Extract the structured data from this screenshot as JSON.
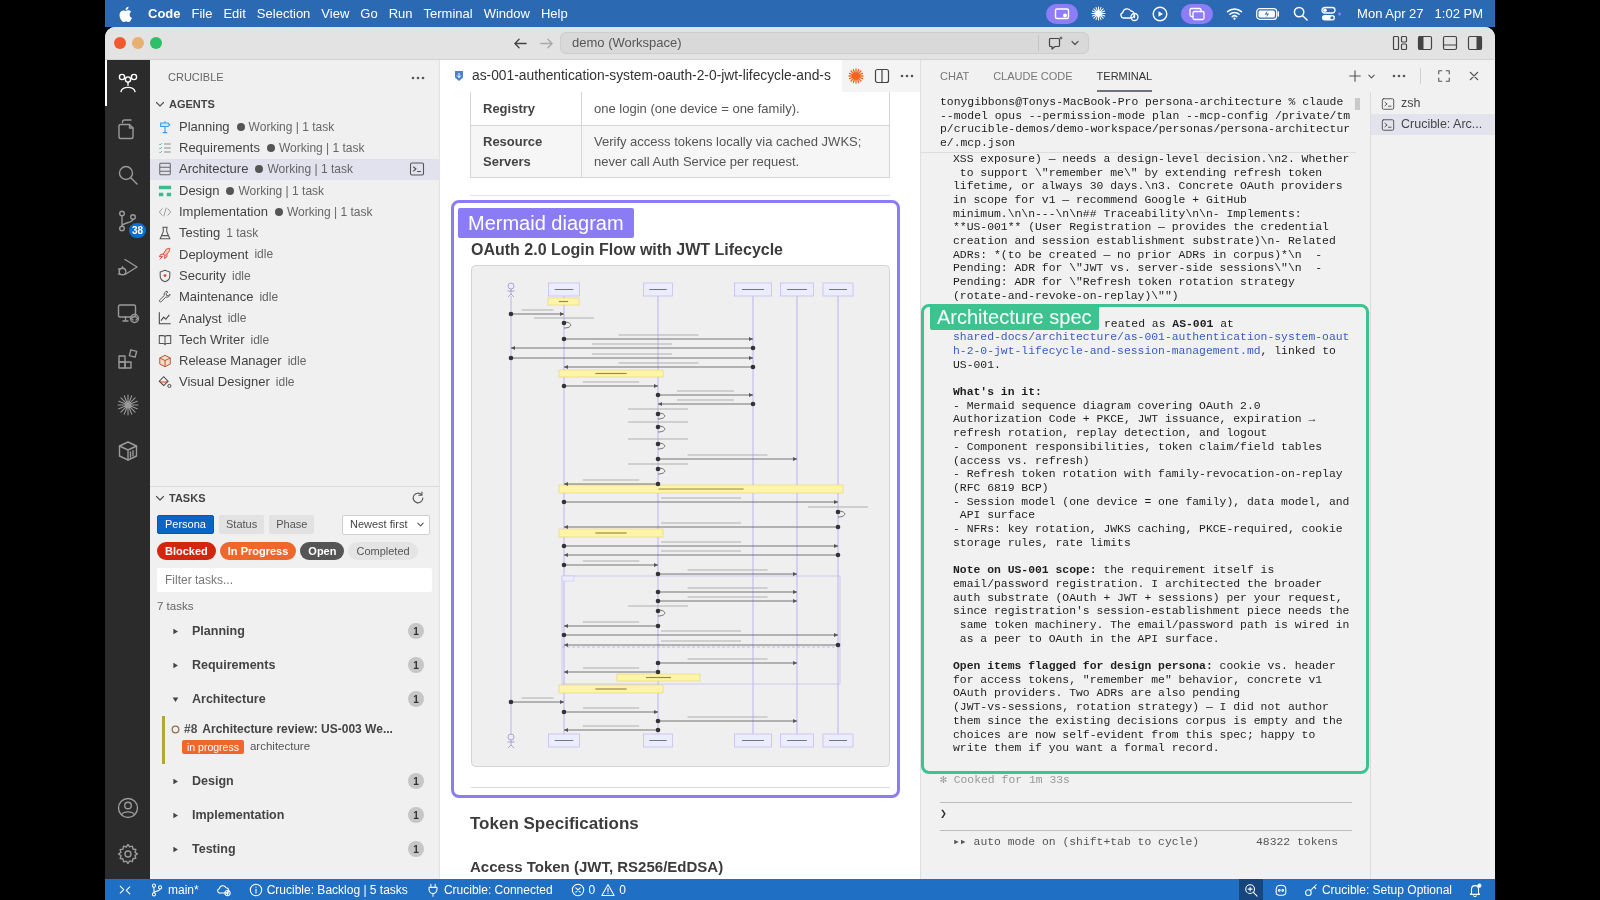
{
  "menu_bar": {
    "app": "Code",
    "menus": [
      "File",
      "Edit",
      "Selection",
      "View",
      "Go",
      "Run",
      "Terminal",
      "Window",
      "Help"
    ],
    "date": "Mon Apr 27",
    "time": "1:02 PM"
  },
  "title_bar": {
    "back": {
      "disabled": false
    },
    "forward": {
      "disabled": true
    },
    "command_center": "demo (Workspace)"
  },
  "activity_bar": {
    "items": [
      {
        "selected": true
      },
      {
        "selected": false
      },
      {
        "selected": false
      },
      {
        "selected": false,
        "badge": "38"
      },
      {
        "selected": false
      },
      {
        "selected": false
      },
      {
        "selected": false
      },
      {
        "selected": false
      },
      {
        "selected": false
      }
    ]
  },
  "sidebar": {
    "title": "CRUCIBLE",
    "agents": {
      "title": "AGENTS",
      "expanded": true,
      "items": [
        {
          "name": "Planning",
          "status": "Working | 1 task",
          "working": true,
          "selected": false
        },
        {
          "name": "Requirements",
          "status": "Working | 1 task",
          "working": true,
          "selected": false
        },
        {
          "name": "Architecture",
          "status": "Working | 1 task",
          "working": true,
          "selected": true
        },
        {
          "name": "Design",
          "status": "Working | 1 task",
          "working": true,
          "selected": false
        },
        {
          "name": "Implementation",
          "status": "Working | 1 task",
          "working": true,
          "selected": false
        },
        {
          "name": "Testing",
          "status": "1 task",
          "working": false,
          "selected": false
        },
        {
          "name": "Deployment",
          "status": "idle",
          "working": false,
          "selected": false
        },
        {
          "name": "Security",
          "status": "idle",
          "working": false,
          "selected": false
        },
        {
          "name": "Maintenance",
          "status": "idle",
          "working": false,
          "selected": false
        },
        {
          "name": "Analyst",
          "status": "idle",
          "working": false,
          "selected": false
        },
        {
          "name": "Tech Writer",
          "status": "idle",
          "working": false,
          "selected": false
        },
        {
          "name": "Release Manager",
          "status": "idle",
          "working": false,
          "selected": false
        },
        {
          "name": "Visual Designer",
          "status": "idle",
          "working": false,
          "selected": false
        }
      ]
    },
    "tasks": {
      "title": "TASKS",
      "expanded": true,
      "group_by": [
        {
          "label": "Persona",
          "selected": true
        },
        {
          "label": "Status",
          "selected": false
        },
        {
          "label": "Phase",
          "selected": false
        }
      ],
      "sort": "Newest first",
      "status_filters": [
        {
          "label": "Blocked",
          "selected": true,
          "color": "#d3260f"
        },
        {
          "label": "In Progress",
          "selected": true,
          "color": "#f0672b"
        },
        {
          "label": "Open",
          "selected": true,
          "color": "#555555"
        },
        {
          "label": "Completed",
          "selected": false
        }
      ],
      "filter": {
        "placeholder": "Filter tasks..."
      },
      "count": "7 tasks",
      "groups": [
        {
          "name": "Planning",
          "count": "1",
          "expanded": false
        },
        {
          "name": "Requirements",
          "count": "1",
          "expanded": false
        },
        {
          "name": "Architecture",
          "count": "1",
          "expanded": true,
          "tasks": [
            {
              "number": "#8",
              "title": "Architecture review: US-003 We...",
              "status": {
                "label": "in progress",
                "color": "#f0672b"
              },
              "tag": "architecture"
            }
          ]
        },
        {
          "name": "Design",
          "count": "1",
          "expanded": false
        },
        {
          "name": "Implementation",
          "count": "1",
          "expanded": false
        },
        {
          "name": "Testing",
          "count": "1",
          "expanded": false
        }
      ]
    }
  },
  "editor": {
    "tab": {
      "title": "as-001-authentication-system-oauth-2-0-jwt-lifecycle-and-s"
    },
    "table": {
      "rows": [
        [
          "Registry",
          "one login (one device = one family)."
        ],
        [
          "Resource Servers",
          "Verify access tokens locally via cached JWKS; never call Auth Service per request."
        ]
      ]
    },
    "highlight": {
      "label": "Mermaid diagram"
    },
    "diagram_heading": "OAuth 2.0 Login Flow with JWT Lifecycle",
    "headings": [
      "Token Specifications",
      "Access Token (JWT, RS256/EdDSA)"
    ]
  },
  "panel": {
    "tabs": [
      {
        "label": "CHAT",
        "selected": false
      },
      {
        "label": "CLAUDE CODE",
        "selected": false
      },
      {
        "label": "TERMINAL",
        "selected": true
      }
    ],
    "terminal": {
      "command": "tonygibbons@Tonys-MacBook-Pro persona-architecture % claude\n--model opus --permission-mode plan --mcp-config /private/tm\np/crucible-demos/demo-workspace/personas/persona-architectur\ne/.mcp.json",
      "output": "XSS exposure) — needs a design-level decision.\\n2. Whether\n to support \\\"remember me\\\" by extending refresh token\nlifetime, or always 30 days.\\n3. Concrete OAuth providers\nin scope for v1 — recommend Google + GitHub\nminimum.\\n\\n---\\n\\n## Traceability\\n\\n- Implements:\n**US-001** (User Registration — provides the credential\ncreation and session establishment substrate)\\n- Related\nADRs: *(to be created — no prior ADRs in corpus)*\\n  -\nPending: ADR for \\\"JWT vs. server-side sessions\\\"\\n  -\nPending: ADR for \\\"Refresh token rotation strategy\n(rotate-and-revoke-on-replay)\\\"\")",
      "highlight": {
        "label": "Architecture spec"
      },
      "spec": {
        "lead": "reated as **AS-001** at",
        "link": "shared-docs/architecture/as-001-authentication-system-oaut\nh-2-0-jwt-lifecycle-and-session-management.md",
        "tail": ", linked to\nUS-001.",
        "list_title": "What's in it:",
        "list": [
          "- Mermaid sequence diagram covering OAuth 2.0\nAuthorization Code + PKCE, JWT issuance, expiration →\nrefresh rotation, replay detection, and logout",
          "- Component responsibilities, token claim/field tables\n(access vs. refresh)",
          "- Refresh token rotation with family-revocation-on-replay\n(RFC 6819 BCP)",
          "- Session model (one device = one family), data model, and\n API surface",
          "- NFRs: key rotation, JWKS caching, PKCE-required, cookie\nstorage rules, rate limits"
        ],
        "note": "**Note on US-001 scope:** the requirement itself is\nemail/password registration. I architected the broader\nauth substrate (OAuth + JWT + sessions) per your request,\nsince registration's session-establishment piece needs the\n same token machinery. The email/password path is wired in\n as a peer to OAuth in the API surface.",
        "open_items": "**Open items flagged for design persona:** cookie vs. header\nfor access tokens, \"remember me\" behavior, concrete v1\nOAuth providers. Two ADRs are also pending\n(JWT-vs-sessions, rotation strategy) — I did not author\nthem since the existing decisions corpus is empty and the\nchoices are now self-evident from this spec; happy to\nwrite them if you want a formal record."
      },
      "elapsed": "✻ Cooked for 1m 33s",
      "prompt": "❯",
      "mode": "▸▸ auto mode on (shift+tab to cycle)",
      "tokens": "48322 tokens"
    },
    "sessions": [
      {
        "label": "zsh",
        "selected": false
      },
      {
        "label": "Crucible: Arc...",
        "selected": true
      }
    ]
  },
  "status_bar": {
    "left": [
      {
        "kind": "remote",
        "active": false
      },
      {
        "kind": "branch",
        "text": "main*",
        "active": false
      },
      {
        "kind": "sync",
        "active": false
      },
      {
        "kind": "info",
        "text": "Crucible: Backlog | 5 tasks",
        "active": false
      },
      {
        "kind": "plug",
        "text": "Crucible: Connected",
        "active": false
      },
      {
        "kind": "problems",
        "errors": "0",
        "warnings": "0",
        "active": false
      }
    ],
    "right": [
      {
        "kind": "zoom",
        "active": true
      },
      {
        "kind": "assistant",
        "active": false
      },
      {
        "kind": "key",
        "text": "Crucible: Setup Optional",
        "active": false
      },
      {
        "kind": "bell",
        "active": false
      }
    ]
  }
}
